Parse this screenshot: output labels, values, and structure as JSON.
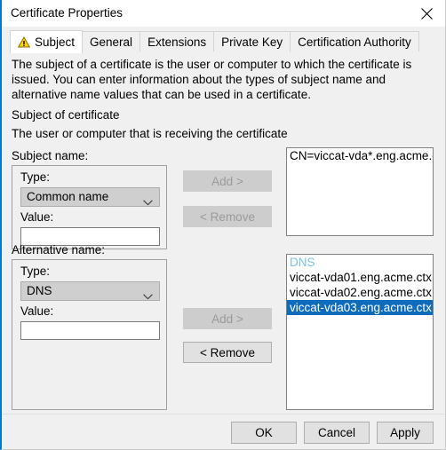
{
  "window": {
    "title": "Certificate Properties",
    "close_icon": "close-icon"
  },
  "tabs": [
    {
      "label": "Subject",
      "active": true,
      "icon": "warning-triangle-icon"
    },
    {
      "label": "General",
      "active": false
    },
    {
      "label": "Extensions",
      "active": false
    },
    {
      "label": "Private Key",
      "active": false
    },
    {
      "label": "Certification Authority",
      "active": false
    }
  ],
  "description": "The subject of a certificate is the user or computer to which the certificate is issued. You can enter information about the types of subject name and alternative name values that can be used in a certificate.",
  "subject_of_certificate": {
    "heading": "Subject of certificate",
    "subheading": "The user or computer that is receiving the certificate"
  },
  "subject_name": {
    "group_label": "Subject name:",
    "type_label": "Type:",
    "type_value": "Common name",
    "value_label": "Value:",
    "value_text": "",
    "value_placeholder": "",
    "add_button": "Add >",
    "add_enabled": false,
    "remove_button": "< Remove",
    "remove_enabled": false,
    "list_items": [
      {
        "text": "CN=viccat-vda*.eng.acme.ctx",
        "selected": false,
        "header": false
      }
    ]
  },
  "alternative_name": {
    "group_label": "Alternative name:",
    "type_label": "Type:",
    "type_value": "DNS",
    "value_label": "Value:",
    "value_text": "",
    "value_placeholder": "",
    "add_button": "Add >",
    "add_enabled": false,
    "remove_button": "< Remove",
    "remove_enabled": true,
    "list_items": [
      {
        "text": "DNS",
        "selected": false,
        "header": true
      },
      {
        "text": "viccat-vda01.eng.acme.ctx",
        "selected": false,
        "header": false
      },
      {
        "text": "viccat-vda02.eng.acme.ctx",
        "selected": false,
        "header": false
      },
      {
        "text": "viccat-vda03.eng.acme.ctx",
        "selected": true,
        "header": false
      }
    ]
  },
  "dialog_buttons": {
    "ok": "OK",
    "cancel": "Cancel",
    "apply": "Apply"
  },
  "colors": {
    "accent": "#0078d7",
    "selection": "#0f6cbd",
    "group_header": "#7cc0e8",
    "window_bg": "#f0f0f0",
    "warning_yellow": "#ffd300"
  }
}
